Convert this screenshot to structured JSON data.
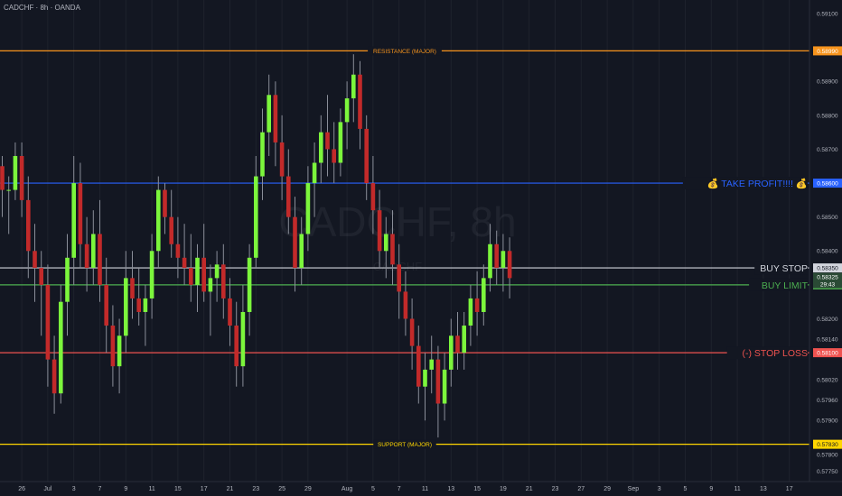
{
  "header": {
    "title": "CADCHF · 8h · OANDA"
  },
  "watermark": {
    "symbol": "CADCHF, 8h",
    "sub": "CADCHF"
  },
  "colors": {
    "background": "#131722",
    "grid": "#1e222d",
    "bull": "#7cf63c",
    "bear": "#c22a2a",
    "wick": "#8a8e99",
    "resistance": "#f7941d",
    "take_profit": "#2962ff",
    "buy_stop": "#d1d4dc",
    "buy_limit": "#4caf50",
    "stop_loss": "#ef5350",
    "support": "#ffd600"
  },
  "chart_data": {
    "type": "candlestick",
    "symbol": "CADCHF",
    "timeframe": "8h",
    "broker": "OANDA",
    "y_range": [
      0.5772,
      0.5914
    ],
    "y_ticks": [
      0.591,
      0.5899,
      0.589,
      0.588,
      0.587,
      0.586,
      0.585,
      0.584,
      0.5835,
      0.582,
      0.5814,
      0.581,
      0.5802,
      0.5796,
      0.579,
      0.5783,
      0.578,
      0.5775
    ],
    "x_ticks": [
      {
        "label": "26",
        "index": 3
      },
      {
        "label": "Jul",
        "index": 7
      },
      {
        "label": "3",
        "index": 11
      },
      {
        "label": "7",
        "index": 15
      },
      {
        "label": "9",
        "index": 19
      },
      {
        "label": "11",
        "index": 23
      },
      {
        "label": "15",
        "index": 27
      },
      {
        "label": "17",
        "index": 31
      },
      {
        "label": "21",
        "index": 35
      },
      {
        "label": "23",
        "index": 39
      },
      {
        "label": "25",
        "index": 43
      },
      {
        "label": "29",
        "index": 47
      },
      {
        "label": "Aug",
        "index": 53
      },
      {
        "label": "5",
        "index": 57
      },
      {
        "label": "7",
        "index": 61
      },
      {
        "label": "11",
        "index": 65
      },
      {
        "label": "13",
        "index": 69
      },
      {
        "label": "15",
        "index": 73
      },
      {
        "label": "19",
        "index": 77
      },
      {
        "label": "21",
        "index": 81
      },
      {
        "label": "23",
        "index": 85
      },
      {
        "label": "27",
        "index": 89
      },
      {
        "label": "29",
        "index": 93
      },
      {
        "label": "Sep",
        "index": 97
      },
      {
        "label": "3",
        "index": 101
      },
      {
        "label": "5",
        "index": 105
      },
      {
        "label": "9",
        "index": 109
      },
      {
        "label": "11",
        "index": 113
      },
      {
        "label": "13",
        "index": 117
      },
      {
        "label": "17",
        "index": 121
      }
    ],
    "levels": [
      {
        "name": "RESISTANCE (MAJOR)",
        "price": 0.5899,
        "price_label": "0.58990",
        "color_key": "resistance",
        "label_pos": "center-small"
      },
      {
        "name": "💰 TAKE PROFIT!!!! 💰",
        "price": 0.586,
        "price_label": "0.58600",
        "color_key": "take_profit",
        "label_pos": "right-big"
      },
      {
        "name": "BUY STOP",
        "price": 0.5835,
        "price_label": "0.58350",
        "color_key": "buy_stop",
        "label_pos": "right-big"
      },
      {
        "name": "BUY LIMIT",
        "price": 0.583,
        "price_label": "0.58300",
        "color_key": "buy_limit",
        "label_pos": "right-big"
      },
      {
        "name": "(-) STOP LOSS",
        "price": 0.581,
        "price_label": "0.58100",
        "color_key": "stop_loss",
        "label_pos": "right-big"
      },
      {
        "name": "SUPPORT (MAJOR)",
        "price": 0.5783,
        "price_label": "0.57830",
        "color_key": "support",
        "label_pos": "center-small"
      }
    ],
    "last_price": {
      "price": 0.58325,
      "label": "0.58325",
      "countdown": "29:43"
    },
    "candles": [
      [
        0.5865,
        0.5868,
        0.585,
        0.5858
      ],
      [
        0.5858,
        0.5862,
        0.5845,
        0.5858
      ],
      [
        0.5858,
        0.5872,
        0.5855,
        0.5868
      ],
      [
        0.5868,
        0.5872,
        0.585,
        0.5855
      ],
      [
        0.5855,
        0.5862,
        0.5832,
        0.584
      ],
      [
        0.584,
        0.5848,
        0.5825,
        0.5835
      ],
      [
        0.5835,
        0.584,
        0.5815,
        0.583
      ],
      [
        0.583,
        0.5836,
        0.58,
        0.5808
      ],
      [
        0.5808,
        0.5815,
        0.5792,
        0.5798
      ],
      [
        0.5798,
        0.583,
        0.5795,
        0.5825
      ],
      [
        0.5825,
        0.5845,
        0.5815,
        0.5838
      ],
      [
        0.5838,
        0.5868,
        0.583,
        0.586
      ],
      [
        0.586,
        0.5866,
        0.5835,
        0.5842
      ],
      [
        0.5842,
        0.585,
        0.5828,
        0.5835
      ],
      [
        0.5835,
        0.5852,
        0.583,
        0.5845
      ],
      [
        0.5845,
        0.5855,
        0.5825,
        0.583
      ],
      [
        0.583,
        0.5838,
        0.581,
        0.5818
      ],
      [
        0.5818,
        0.5824,
        0.58,
        0.5806
      ],
      [
        0.5806,
        0.582,
        0.5798,
        0.5815
      ],
      [
        0.5815,
        0.584,
        0.581,
        0.5832
      ],
      [
        0.5832,
        0.584,
        0.582,
        0.5826
      ],
      [
        0.5826,
        0.5835,
        0.5818,
        0.5822
      ],
      [
        0.5822,
        0.583,
        0.5812,
        0.5826
      ],
      [
        0.5826,
        0.5845,
        0.582,
        0.584
      ],
      [
        0.584,
        0.5862,
        0.5835,
        0.5858
      ],
      [
        0.5858,
        0.586,
        0.5845,
        0.585
      ],
      [
        0.585,
        0.5858,
        0.5838,
        0.5842
      ],
      [
        0.5842,
        0.585,
        0.5832,
        0.5838
      ],
      [
        0.5838,
        0.5848,
        0.583,
        0.5835
      ],
      [
        0.5835,
        0.5845,
        0.5825,
        0.583
      ],
      [
        0.583,
        0.5842,
        0.5822,
        0.5838
      ],
      [
        0.5838,
        0.5848,
        0.5825,
        0.5828
      ],
      [
        0.5828,
        0.5836,
        0.5815,
        0.5832
      ],
      [
        0.5832,
        0.584,
        0.5825,
        0.5836
      ],
      [
        0.5836,
        0.5842,
        0.582,
        0.5826
      ],
      [
        0.5826,
        0.5832,
        0.5812,
        0.5818
      ],
      [
        0.5818,
        0.5825,
        0.58,
        0.5806
      ],
      [
        0.5806,
        0.583,
        0.58,
        0.5822
      ],
      [
        0.5822,
        0.5842,
        0.5815,
        0.5838
      ],
      [
        0.5838,
        0.5868,
        0.5835,
        0.5862
      ],
      [
        0.5862,
        0.5882,
        0.5855,
        0.5875
      ],
      [
        0.5875,
        0.5892,
        0.5868,
        0.5886
      ],
      [
        0.5886,
        0.589,
        0.5865,
        0.5872
      ],
      [
        0.5872,
        0.588,
        0.5855,
        0.5862
      ],
      [
        0.5862,
        0.587,
        0.5845,
        0.585
      ],
      [
        0.585,
        0.5856,
        0.5828,
        0.5835
      ],
      [
        0.5835,
        0.585,
        0.583,
        0.5845
      ],
      [
        0.5845,
        0.5865,
        0.584,
        0.586
      ],
      [
        0.586,
        0.5872,
        0.585,
        0.5866
      ],
      [
        0.5866,
        0.588,
        0.586,
        0.5875
      ],
      [
        0.5875,
        0.5886,
        0.5862,
        0.587
      ],
      [
        0.587,
        0.5878,
        0.586,
        0.5866
      ],
      [
        0.5866,
        0.5882,
        0.5862,
        0.5878
      ],
      [
        0.5878,
        0.589,
        0.587,
        0.5885
      ],
      [
        0.5885,
        0.5898,
        0.5878,
        0.5892
      ],
      [
        0.5892,
        0.5896,
        0.587,
        0.5876
      ],
      [
        0.5876,
        0.588,
        0.5855,
        0.586
      ],
      [
        0.586,
        0.5868,
        0.5845,
        0.5852
      ],
      [
        0.5852,
        0.5858,
        0.5835,
        0.584
      ],
      [
        0.584,
        0.585,
        0.5832,
        0.5845
      ],
      [
        0.5845,
        0.5852,
        0.583,
        0.5836
      ],
      [
        0.5836,
        0.5842,
        0.582,
        0.5828
      ],
      [
        0.5828,
        0.5834,
        0.5815,
        0.582
      ],
      [
        0.582,
        0.5826,
        0.5805,
        0.5812
      ],
      [
        0.5812,
        0.5818,
        0.5795,
        0.58
      ],
      [
        0.58,
        0.581,
        0.579,
        0.5805
      ],
      [
        0.5805,
        0.5815,
        0.5798,
        0.5808
      ],
      [
        0.5808,
        0.5812,
        0.5785,
        0.5795
      ],
      [
        0.5795,
        0.581,
        0.579,
        0.5805
      ],
      [
        0.5805,
        0.582,
        0.58,
        0.5815
      ],
      [
        0.5815,
        0.5822,
        0.5805,
        0.581
      ],
      [
        0.581,
        0.5822,
        0.5805,
        0.5818
      ],
      [
        0.5818,
        0.583,
        0.5812,
        0.5826
      ],
      [
        0.5826,
        0.5834,
        0.5815,
        0.5822
      ],
      [
        0.5822,
        0.5836,
        0.5818,
        0.5832
      ],
      [
        0.5832,
        0.5848,
        0.5828,
        0.5842
      ],
      [
        0.5842,
        0.5846,
        0.583,
        0.5835
      ],
      [
        0.5835,
        0.5845,
        0.5828,
        0.584
      ],
      [
        0.584,
        0.5844,
        0.5826,
        0.5832
      ]
    ]
  }
}
